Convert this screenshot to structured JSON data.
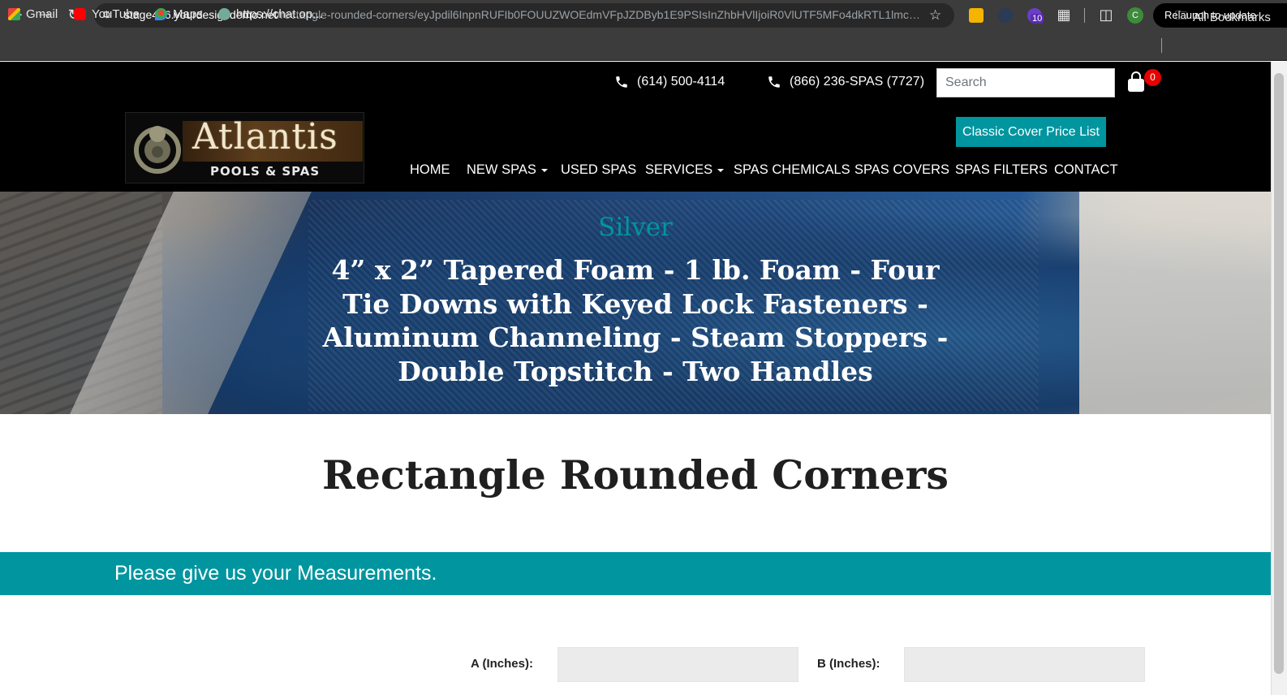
{
  "browser": {
    "url_host": "stage446.yourdesigndemo.net",
    "url_path": "/rectangle-rounded-corners/eyJpdil6InpnRUFIb0FOUUZWOEdmVFpJZDByb1E9PSIsInZhbHVlIjoiR0VlUTF5MFo4dkRTL1lmckpY...",
    "relaunch_label": "Relaunch to update",
    "extension_badge": "10",
    "profile_initial": "C",
    "bookmarks": [
      {
        "label": "Gmail",
        "icon": "gmail-icon"
      },
      {
        "label": "YouTube",
        "icon": "youtube-icon"
      },
      {
        "label": "Maps",
        "icon": "maps-icon"
      },
      {
        "label": "https://chat.op...",
        "icon": "chatgpt-icon"
      }
    ],
    "all_bookmarks_label": "All Bookmarks"
  },
  "header": {
    "phone_local": "(614) 500-4114",
    "phone_toll_free": "(866) 236-SPAS (7727)",
    "search_placeholder": "Search",
    "cart_count": "0",
    "logo_title": "Atlantis",
    "logo_subtitle": "POOLS & SPAS",
    "price_list_button": "Classic Cover Price List",
    "nav": [
      {
        "label": "HOME",
        "dropdown": false
      },
      {
        "label": "NEW SPAS",
        "dropdown": true
      },
      {
        "label": "USED SPAS",
        "dropdown": false
      },
      {
        "label": "SERVICES",
        "dropdown": true
      },
      {
        "label": "SPAS CHEMICALS",
        "dropdown": false
      },
      {
        "label": "SPAS COVERS",
        "dropdown": false
      },
      {
        "label": "SPAS FILTERS",
        "dropdown": false
      },
      {
        "label": "CONTACT",
        "dropdown": false
      }
    ]
  },
  "hero": {
    "subtitle": "Silver",
    "title": "4” x 2” Tapered Foam - 1 lb. Foam - Four Tie Downs with Keyed Lock Fasteners - Aluminum Channeling - Steam Stoppers - Double Topstitch - Two Handles"
  },
  "main": {
    "page_title": "Rectangle Rounded Corners",
    "band_text": "Please give us your Measurements.",
    "fields": [
      {
        "label": "A (Inches):",
        "value": ""
      },
      {
        "label": "B (Inches):",
        "value": ""
      }
    ]
  },
  "colors": {
    "accent": "#00959f",
    "header_bg": "#000000",
    "cart_badge": "#e60000"
  }
}
